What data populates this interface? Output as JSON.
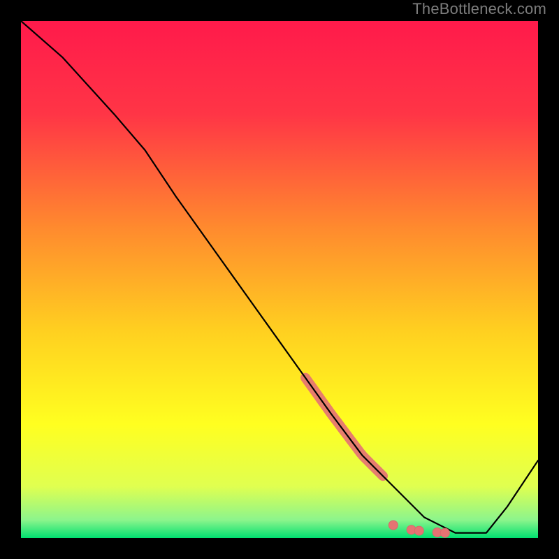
{
  "watermark": "TheBottleneck.com",
  "colors": {
    "frame": "#000000",
    "watermark": "#7d7d7d",
    "gradient_stops": [
      {
        "offset": 0.0,
        "color": "#ff1a4b"
      },
      {
        "offset": 0.18,
        "color": "#ff3546"
      },
      {
        "offset": 0.4,
        "color": "#ff8a2e"
      },
      {
        "offset": 0.6,
        "color": "#ffd020"
      },
      {
        "offset": 0.78,
        "color": "#ffff20"
      },
      {
        "offset": 0.9,
        "color": "#e0ff50"
      },
      {
        "offset": 0.965,
        "color": "#8cf58c"
      },
      {
        "offset": 1.0,
        "color": "#00e070"
      }
    ],
    "curve": "#000000",
    "marker_fill": "#e57373",
    "marker_stroke": "#d86a6a"
  },
  "chart_data": {
    "type": "line",
    "title": "",
    "xlabel": "",
    "ylabel": "",
    "xlim": [
      0,
      100
    ],
    "ylim": [
      0,
      100
    ],
    "series": [
      {
        "name": "curve",
        "x": [
          0,
          8,
          18,
          24,
          30,
          40,
          50,
          60,
          66,
          72,
          78,
          84,
          90,
          94,
          100
        ],
        "y": [
          100,
          93,
          82,
          75,
          66,
          52,
          38,
          24,
          16,
          10,
          4,
          1,
          1,
          6,
          15
        ]
      }
    ],
    "markers": {
      "thick_segment": {
        "x_start": 55,
        "x_end": 70,
        "note": "salmon thick overlay along curve"
      },
      "dots": [
        {
          "x": 72.0,
          "y": 2.5
        },
        {
          "x": 75.5,
          "y": 1.6
        },
        {
          "x": 77.0,
          "y": 1.4
        },
        {
          "x": 80.5,
          "y": 1.1
        },
        {
          "x": 82.0,
          "y": 1.0
        }
      ]
    }
  }
}
